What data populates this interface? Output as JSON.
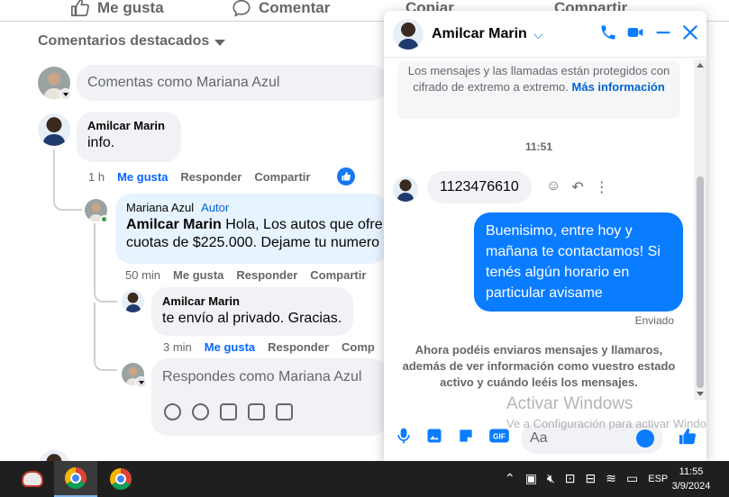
{
  "post_actions": {
    "like": "Me gusta",
    "comment": "Comentar",
    "copy": "Copiar",
    "share": "Compartir"
  },
  "comments": {
    "sort_label": "Comentarios destacados",
    "compose_placeholder": "Comentas como Mariana Azul",
    "top": {
      "author": "Amilcar Marin",
      "text": "info.",
      "time": "1 h",
      "like": "Me gusta",
      "reply": "Responder",
      "share": "Compartir"
    },
    "reply1": {
      "author": "Mariana Azul",
      "badge": "Autor",
      "mention": "Amilcar Marin",
      "text_line1": " Hola, Los autos que ofre",
      "text_line2": "cuotas de $225.000. Dejame tu numero",
      "time": "50 min",
      "like": "Me gusta",
      "reply": "Responder",
      "share": "Compartir"
    },
    "reply2": {
      "author": "Amilcar Marin",
      "text": "te envío al privado. Gracias.",
      "time": "3 min",
      "like": "Me gusta",
      "reply": "Responder",
      "share": "Comp"
    },
    "reply_placeholder": "Respondes como Mariana Azul"
  },
  "chat": {
    "contact_name": "Amilcar Marin",
    "encryption_notice": "Los mensajes y las llamadas están protegidos con cifrado de extremo a extremo.",
    "more_info": "Más información",
    "time": "11:51",
    "incoming_message": "1123476610",
    "outgoing_message": "Buenisimo, entre hoy y mañana te contactamos! Si tenés algún horario en particular avisame",
    "status": "Enviado",
    "info_note": "Ahora podéis enviaros mensajes y llamaros, además de ver información como vuestro estado activo y cuándo leéis los mensajes.",
    "composer_placeholder": "Aa",
    "accent_color": "#0a7cff"
  },
  "watermark": {
    "title": "Activar Windows",
    "subtitle": "Ve a Configuración para activar Windo"
  },
  "taskbar": {
    "language": "ESP",
    "time": "11:55",
    "date": "3/9/2024"
  }
}
